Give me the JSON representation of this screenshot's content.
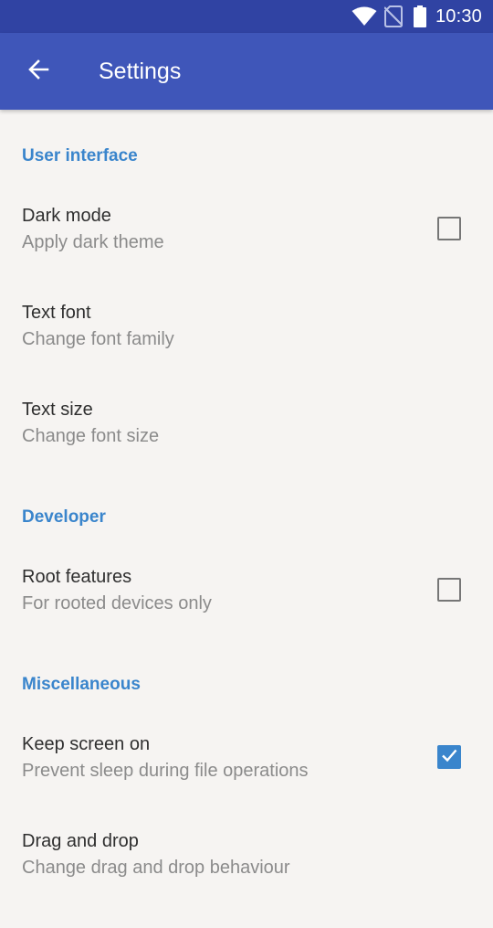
{
  "status_bar": {
    "time": "10:30",
    "icons": [
      "wifi-icon",
      "no-sim-icon",
      "battery-icon"
    ]
  },
  "app_bar": {
    "back_icon": "arrow-back-icon",
    "title": "Settings"
  },
  "colors": {
    "status_bar": "#3043a3",
    "app_bar": "#3f56b9",
    "accent": "#3a85cc",
    "background": "#f6f4f2"
  },
  "sections": [
    {
      "header": "User interface",
      "items": [
        {
          "title": "Dark mode",
          "summary": "Apply dark theme",
          "checkbox": true,
          "checked": false
        },
        {
          "title": "Text font",
          "summary": "Change font family",
          "checkbox": false
        },
        {
          "title": "Text size",
          "summary": "Change font size",
          "checkbox": false
        }
      ]
    },
    {
      "header": "Developer",
      "items": [
        {
          "title": "Root features",
          "summary": "For rooted devices only",
          "checkbox": true,
          "checked": false
        }
      ]
    },
    {
      "header": "Miscellaneous",
      "items": [
        {
          "title": "Keep screen on",
          "summary": "Prevent sleep during file operations",
          "checkbox": true,
          "checked": true
        },
        {
          "title": "Drag and drop",
          "summary": "Change drag and drop behaviour",
          "checkbox": false
        }
      ]
    }
  ]
}
